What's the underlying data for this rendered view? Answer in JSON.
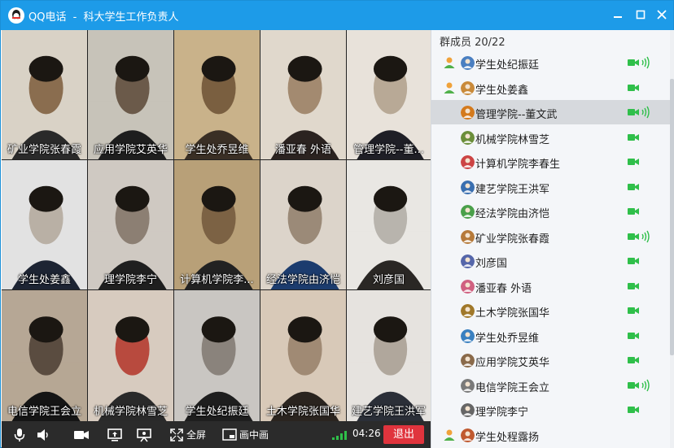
{
  "window": {
    "app_name": "QQ电话",
    "separator": "-",
    "group_name": "科大学生工作负责人"
  },
  "video_grid": [
    {
      "name": "矿业学院张春霞"
    },
    {
      "name": "应用学院艾英华"
    },
    {
      "name": "学生处乔昱维"
    },
    {
      "name": "潘亚春 外语"
    },
    {
      "name": "管理学院--董..."
    },
    {
      "name": "学生处姜鑫"
    },
    {
      "name": "理学院李宁"
    },
    {
      "name": "计算机学院李..."
    },
    {
      "name": "经法学院由济恺"
    },
    {
      "name": "刘彦国"
    },
    {
      "name": "电信学院王会立"
    },
    {
      "name": "机械学院林雪芝"
    },
    {
      "name": "学生处纪振廷"
    },
    {
      "name": "土木学院张国华"
    },
    {
      "name": "建艺学院王洪军"
    }
  ],
  "controls": {
    "mic_icon": "microphone-icon",
    "speaker_icon": "speaker-icon",
    "camera_icon": "camera-icon",
    "share_icon": "screen-share-icon",
    "whiteboard_icon": "presenter-icon",
    "fullscreen_label": "全屏",
    "pip_label": "画中画",
    "timer": "04:26",
    "exit_label": "退出"
  },
  "member_panel": {
    "header": "群成员 20/22",
    "members": [
      {
        "name": "学生处纪振廷",
        "host": true,
        "speaking": true,
        "selected": false
      },
      {
        "name": "学生处姜鑫",
        "host": true,
        "speaking": false,
        "selected": false
      },
      {
        "name": "管理学院--董文武",
        "host": false,
        "speaking": true,
        "selected": true
      },
      {
        "name": "机械学院林雪芝",
        "host": false,
        "speaking": false,
        "selected": false
      },
      {
        "name": "计算机学院李春生",
        "host": false,
        "speaking": false,
        "selected": false
      },
      {
        "name": "建艺学院王洪军",
        "host": false,
        "speaking": false,
        "selected": false
      },
      {
        "name": "经法学院由济恺",
        "host": false,
        "speaking": false,
        "selected": false
      },
      {
        "name": "矿业学院张春霞",
        "host": false,
        "speaking": true,
        "selected": false
      },
      {
        "name": "刘彦国",
        "host": false,
        "speaking": false,
        "selected": false
      },
      {
        "name": "潘亚春 外语",
        "host": false,
        "speaking": false,
        "selected": false
      },
      {
        "name": "土木学院张国华",
        "host": false,
        "speaking": false,
        "selected": false
      },
      {
        "name": "学生处乔昱维",
        "host": false,
        "speaking": false,
        "selected": false
      },
      {
        "name": "应用学院艾英华",
        "host": false,
        "speaking": false,
        "selected": false
      },
      {
        "name": "电信学院王会立",
        "host": false,
        "speaking": true,
        "selected": false
      },
      {
        "name": "理学院李宁",
        "host": false,
        "speaking": false,
        "selected": false
      },
      {
        "name": "学生处程露扬",
        "host": true,
        "speaking": false,
        "selected": false,
        "no_video": true
      }
    ]
  },
  "colors": {
    "titlebar": "#1d9be8",
    "camera_active": "#2fbf4a",
    "exit_button": "#e0343d"
  }
}
